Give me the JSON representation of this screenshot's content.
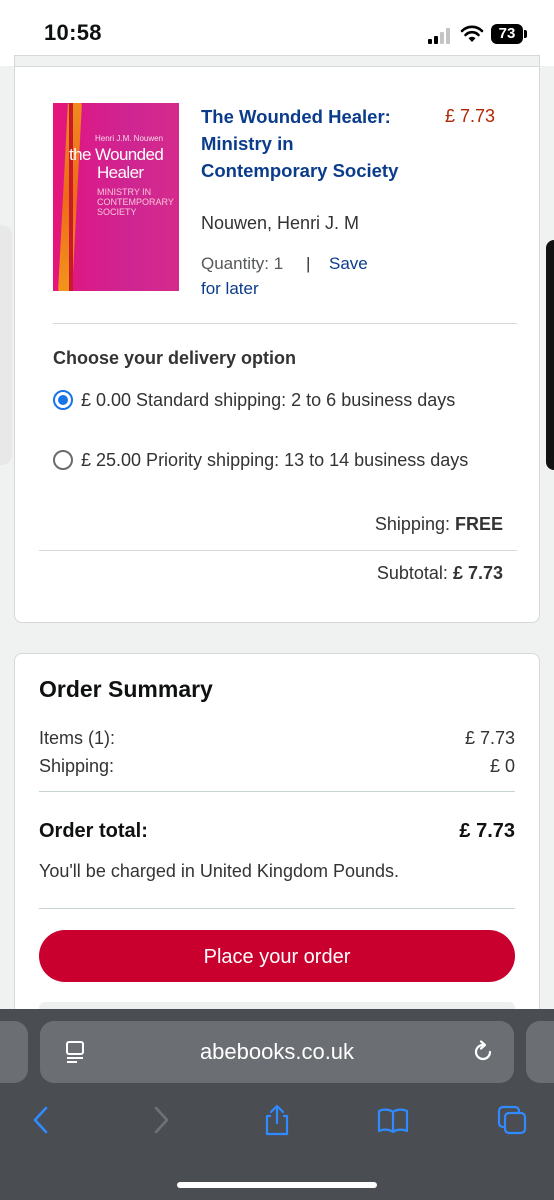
{
  "status_bar": {
    "time": "10:58",
    "battery": "73"
  },
  "item": {
    "cover": {
      "author": "Henri J.M. Nouwen",
      "title_line1": "the Wounded",
      "title_line2": "Healer",
      "subtitle": "MINISTRY IN CONTEMPORARY SOCIETY"
    },
    "title": "The Wounded Healer: Ministry in Contemporary Society",
    "price": "£ 7.73",
    "author": "Nouwen, Henri J. M",
    "quantity": "Quantity: 1",
    "separator": "|",
    "save_part1": "Save",
    "save_part2": "for later"
  },
  "delivery": {
    "heading": "Choose your delivery option",
    "options": [
      {
        "label": "£ 0.00 Standard shipping: 2 to 6 business days",
        "selected": true
      },
      {
        "label": "£ 25.00 Priority shipping: 13 to 14 business days",
        "selected": false
      }
    ],
    "shipping_label": "Shipping:",
    "shipping_value": "FREE",
    "subtotal_label": "Subtotal:",
    "subtotal_value": "£ 7.73"
  },
  "summary": {
    "title": "Order Summary",
    "items_label": "Items (1):",
    "items_value": "£ 7.73",
    "shipping_label": "Shipping:",
    "shipping_value": "£ 0",
    "total_label": "Order total:",
    "total_value": "£ 7.73",
    "currency_note": "You'll be charged in United Kingdom Pounds.",
    "place_order": "Place your order"
  },
  "browser": {
    "url": "abebooks.co.uk"
  },
  "colors": {
    "link": "#0b3c8c",
    "price": "#b12704",
    "button": "#c9002d",
    "radio": "#1a73e8"
  }
}
